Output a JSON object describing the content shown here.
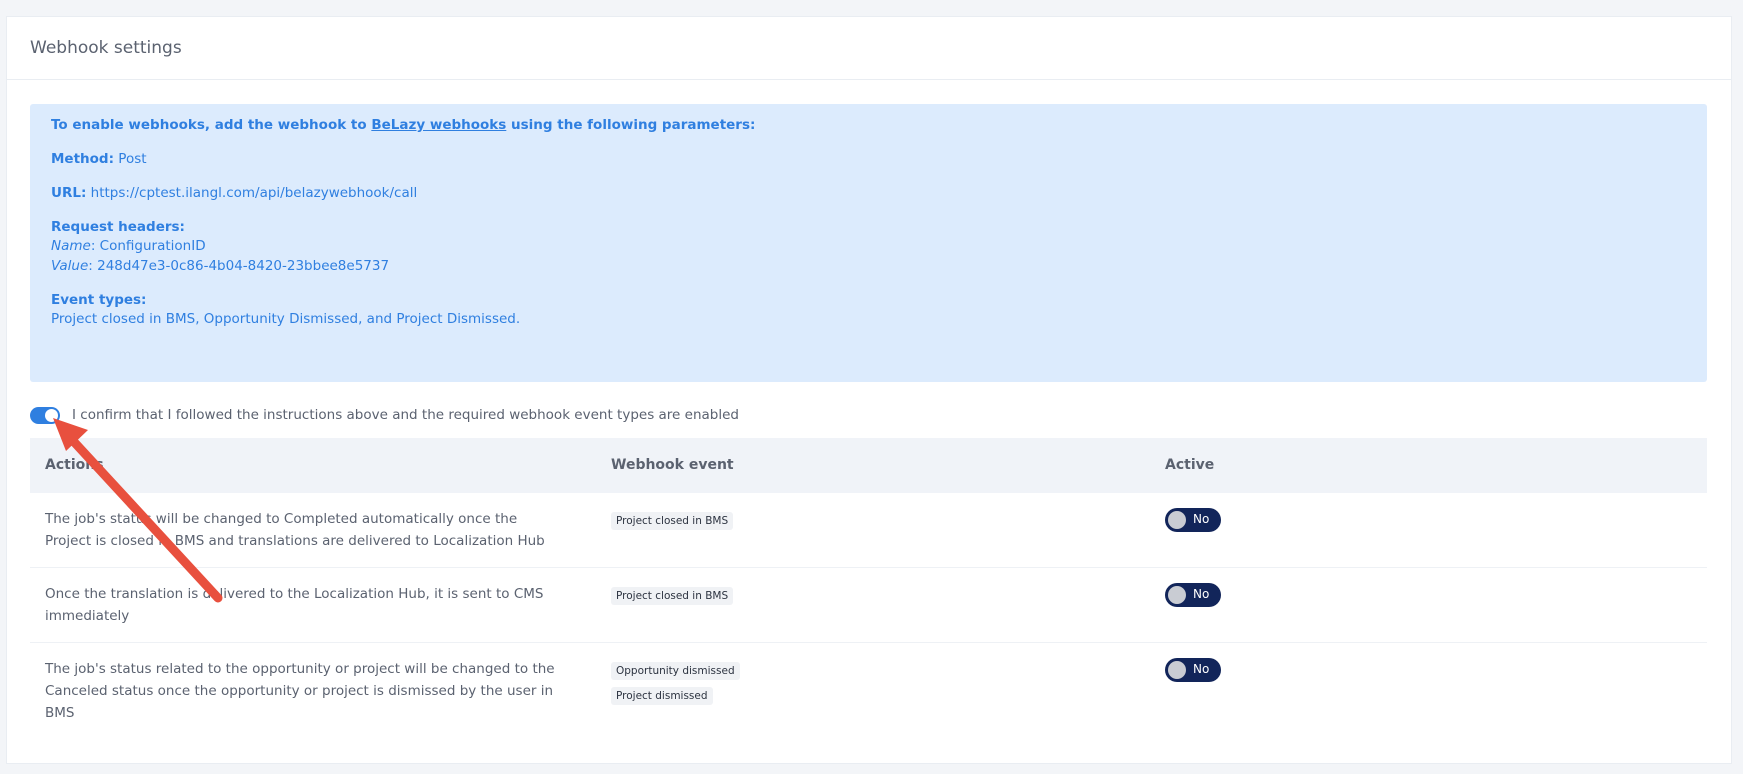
{
  "header": {
    "title": "Webhook settings"
  },
  "info": {
    "intro_prefix": "To enable webhooks, add the webhook to ",
    "intro_link": "BeLazy webhooks",
    "intro_suffix": " using the following parameters:",
    "method_label": "Method:",
    "method_value": "Post",
    "url_label": "URL:",
    "url_value": "https://cptest.ilangl.com/api/belazywebhook/call",
    "headers_label": "Request headers:",
    "name_label": "Name",
    "name_value": ": ConfigurationID",
    "value_label": "Value",
    "value_value": ": 248d47e3-0c86-4b04-8420-23bbee8e5737",
    "event_types_label": "Event types:",
    "event_types_value": "Project closed in BMS, Opportunity Dismissed, and Project Dismissed."
  },
  "confirm": {
    "checked": true,
    "label": "I confirm that I followed the instructions above and the required webhook event types are enabled"
  },
  "table": {
    "columns": [
      "Actions",
      "Webhook event",
      "Active"
    ],
    "rows": [
      {
        "action": "The job's status will be changed to Completed automatically once the Project is closed in BMS and translations are delivered to Localization Hub",
        "events": [
          "Project closed in BMS"
        ],
        "active": "No"
      },
      {
        "action": "Once the translation is delivered to the Localization Hub, it is sent to CMS immediately",
        "events": [
          "Project closed in BMS"
        ],
        "active": "No"
      },
      {
        "action": "The job's status related to the opportunity or project will be changed to the Canceled status once the opportunity or project is dismissed by the user in BMS",
        "events": [
          "Opportunity dismissed",
          "Project dismissed"
        ],
        "active": "No"
      }
    ]
  },
  "colors": {
    "accent": "#2f7fe0",
    "info_bg": "#dcebfd",
    "toggle_off_bg": "#12255a",
    "annotation_arrow": "#e8503e"
  }
}
